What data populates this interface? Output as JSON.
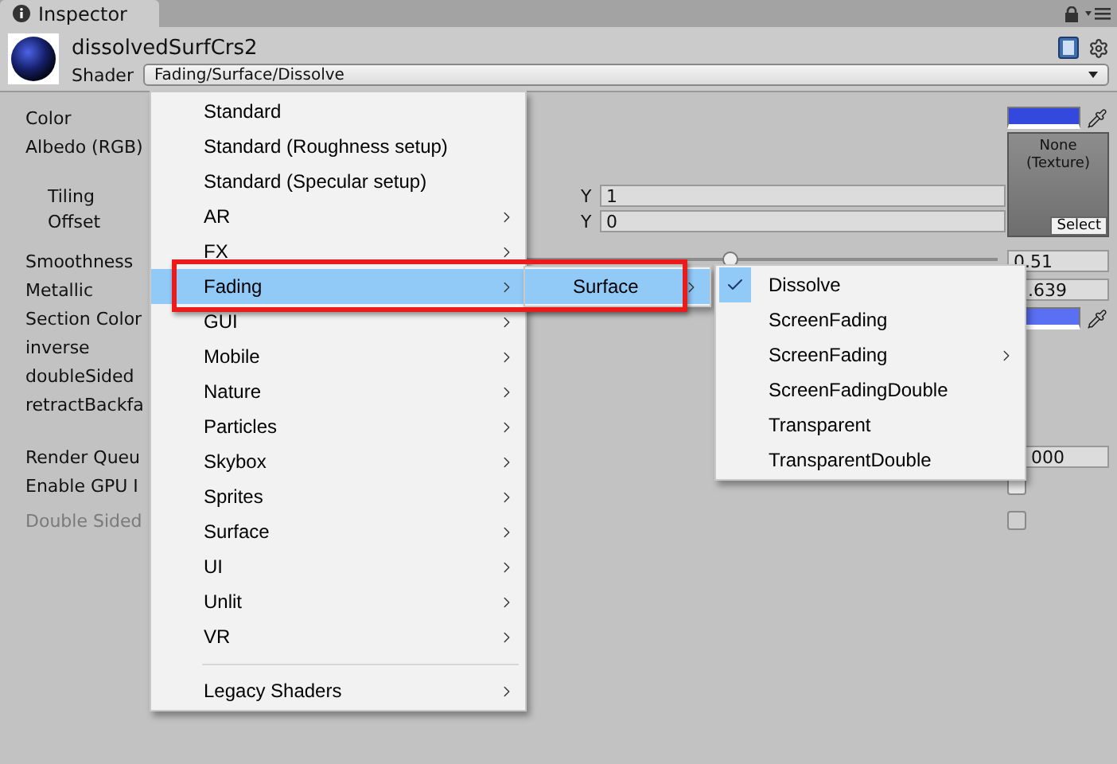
{
  "tab": {
    "label": "Inspector"
  },
  "header": {
    "name": "dissolvedSurfCrs2",
    "shader_label": "Shader",
    "shader_value": "Fading/Surface/Dissolve"
  },
  "properties": [
    {
      "label": "Color",
      "kind": "color",
      "color": "#3349dd"
    },
    {
      "label": "Albedo (RGB)",
      "kind": "texture",
      "texture_text": "None (Texture)",
      "button": "Select",
      "fields": [
        {
          "label": "Tiling",
          "axis": "Y",
          "value": "1"
        },
        {
          "label": "Offset",
          "axis": "Y",
          "value": "0"
        }
      ]
    },
    {
      "label": "Smoothness",
      "kind": "slider",
      "level": 0.51,
      "value": "0.51"
    },
    {
      "label": "Metallic",
      "kind": "number",
      "value": ".639"
    },
    {
      "label": "Section Color",
      "kind": "color",
      "color": "#5b6ff2"
    },
    {
      "label": "inverse",
      "kind": "blank"
    },
    {
      "label": "doubleSided",
      "kind": "blank"
    },
    {
      "label": "retractBackfa",
      "kind": "blank"
    }
  ],
  "settings": [
    {
      "label": "Render Queu",
      "kind": "number",
      "value": "000",
      "disabled": false
    },
    {
      "label": "Enable GPU I",
      "kind": "checkbox",
      "checked": false,
      "disabled": false
    },
    {
      "label": "Double Sided",
      "kind": "checkbox",
      "checked": false,
      "disabled": true
    }
  ],
  "shader_menu": {
    "groups": [
      [
        {
          "label": "Standard",
          "kind": "leaf",
          "selected": false
        },
        {
          "label": "Standard (Roughness setup)",
          "kind": "leaf",
          "selected": false
        },
        {
          "label": "Standard (Specular setup)",
          "kind": "leaf",
          "selected": false
        },
        {
          "label": "AR",
          "kind": "submenu",
          "selected": false
        },
        {
          "label": "FX",
          "kind": "submenu",
          "selected": false
        },
        {
          "label": "Fading",
          "kind": "submenu",
          "selected": true
        },
        {
          "label": "GUI",
          "kind": "submenu",
          "selected": false
        },
        {
          "label": "Mobile",
          "kind": "submenu",
          "selected": false
        },
        {
          "label": "Nature",
          "kind": "submenu",
          "selected": false
        },
        {
          "label": "Particles",
          "kind": "submenu",
          "selected": false
        },
        {
          "label": "Skybox",
          "kind": "submenu",
          "selected": false
        },
        {
          "label": "Sprites",
          "kind": "submenu",
          "selected": false
        },
        {
          "label": "Surface",
          "kind": "submenu",
          "selected": false
        },
        {
          "label": "UI",
          "kind": "submenu",
          "selected": false
        },
        {
          "label": "Unlit",
          "kind": "submenu",
          "selected": false
        },
        {
          "label": "VR",
          "kind": "submenu",
          "selected": false
        }
      ],
      [
        {
          "label": "Legacy Shaders",
          "kind": "submenu",
          "selected": false
        }
      ]
    ]
  },
  "fading_menu": [
    {
      "label": "Surface",
      "kind": "submenu",
      "selected": true
    }
  ],
  "surface_menu": [
    {
      "label": "Dissolve",
      "kind": "leaf",
      "checked": true
    },
    {
      "label": "ScreenFading",
      "kind": "leaf",
      "checked": false
    },
    {
      "label": "ScreenFading",
      "kind": "submenu",
      "checked": false
    },
    {
      "label": "ScreenFadingDouble",
      "kind": "leaf",
      "checked": false
    },
    {
      "label": "Transparent",
      "kind": "leaf",
      "checked": false
    },
    {
      "label": "TransparentDouble",
      "kind": "leaf",
      "checked": false
    }
  ]
}
